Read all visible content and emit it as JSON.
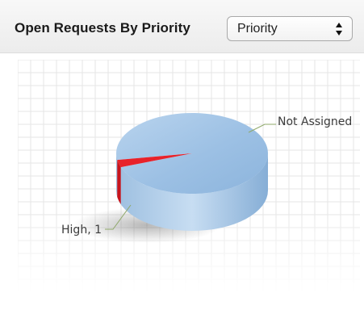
{
  "header": {
    "title": "Open Requests By Priority",
    "select_value": "Priority"
  },
  "colors": {
    "not_assigned": "#9fc3e6",
    "high": "#e8222a",
    "grid": "#e6e6e6",
    "leader": "#8fa86a"
  },
  "chart_data": {
    "type": "pie",
    "title": "",
    "style": "3d",
    "grid": true,
    "slices": [
      {
        "name": "Not Assigned",
        "value": 33,
        "label": "Not Assigned"
      },
      {
        "name": "High",
        "value": 1,
        "label": "High, 1"
      }
    ]
  }
}
